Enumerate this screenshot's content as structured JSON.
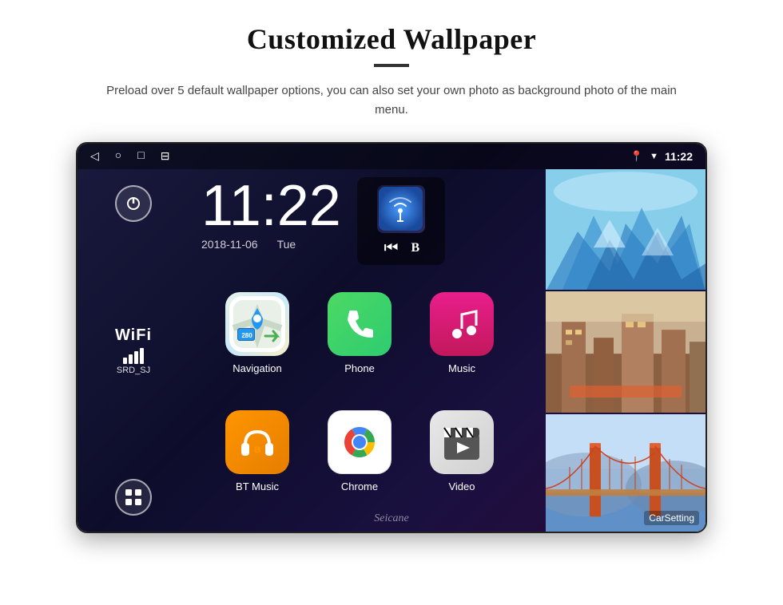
{
  "header": {
    "title": "Customized Wallpaper",
    "description": "Preload over 5 default wallpaper options, you can also set your own photo as background photo of the main menu."
  },
  "device": {
    "statusBar": {
      "time": "11:22",
      "navIcons": [
        "◁",
        "○",
        "□",
        "⊟"
      ],
      "statusIcons": [
        "📍",
        "▼"
      ]
    },
    "clock": {
      "time": "11:22",
      "date": "2018-11-06",
      "day": "Tue"
    },
    "wifi": {
      "label": "WiFi",
      "ssid": "SRD_SJ"
    },
    "apps": [
      {
        "name": "Navigation",
        "type": "navigation"
      },
      {
        "name": "Phone",
        "type": "phone"
      },
      {
        "name": "Music",
        "type": "music"
      },
      {
        "name": "BT Music",
        "type": "btmusic"
      },
      {
        "name": "Chrome",
        "type": "chrome"
      },
      {
        "name": "Video",
        "type": "video"
      }
    ],
    "wallpapers": [
      "ice",
      "building",
      "bridge"
    ],
    "watermark": "Seicane"
  }
}
